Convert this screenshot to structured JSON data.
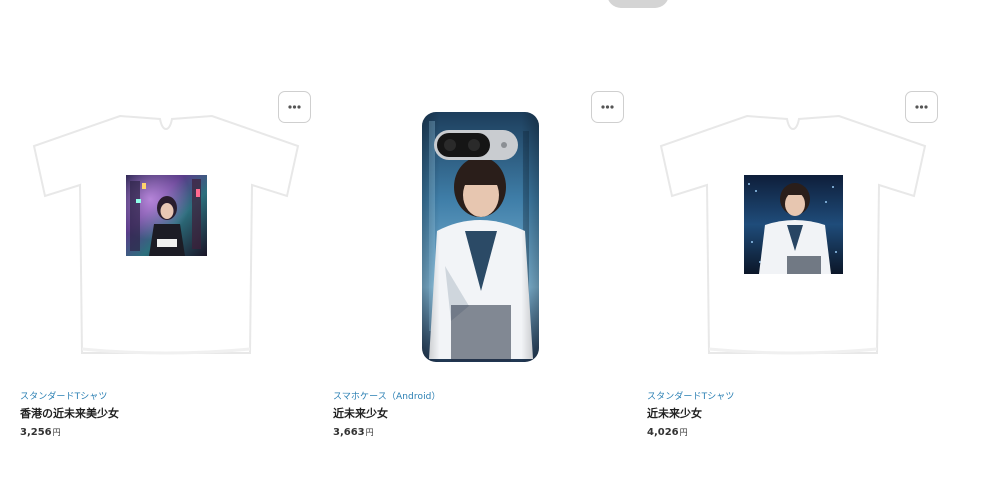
{
  "products": [
    {
      "type": "スタンダードTシャツ",
      "title": "香港の近未来美少女",
      "price": "3,256",
      "currency": "円",
      "product_icon": "tshirt-icon",
      "print_icon": "print-image-icon"
    },
    {
      "type": "スマホケース（Android）",
      "title": "近未来少女",
      "price": "3,663",
      "currency": "円",
      "product_icon": "phone-case-icon",
      "print_icon": "print-image-icon"
    },
    {
      "type": "スタンダードTシャツ",
      "title": "近未来少女",
      "price": "4,026",
      "currency": "円",
      "product_icon": "tshirt-icon",
      "print_icon": "print-image-icon"
    }
  ],
  "menu_icon": "more-dots-icon",
  "colors": {
    "link": "#2a7fb3",
    "title": "#222222",
    "price": "#333333",
    "border": "#cfcfcf",
    "background": "#ffffff"
  }
}
